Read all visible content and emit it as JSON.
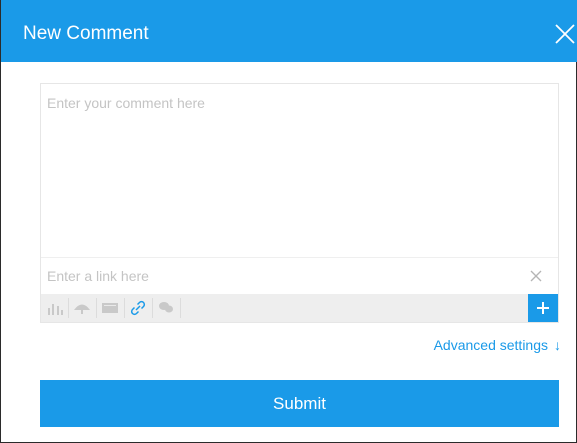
{
  "dialog": {
    "title": "New Comment",
    "close_icon": "close-icon"
  },
  "editor": {
    "comment_placeholder": "Enter your comment here",
    "comment_value": "",
    "link_placeholder": "Enter a link here",
    "link_value": "",
    "clear_icon": "close-icon"
  },
  "toolbar": {
    "items": [
      "bar-chart-icon",
      "umbrella-icon",
      "storyboard-icon",
      "link-icon",
      "comment-icon"
    ],
    "add_label": "+"
  },
  "advanced_settings": {
    "label": "Advanced settings",
    "arrow": "↓"
  },
  "submit": {
    "label": "Submit"
  },
  "colors": {
    "accent": "#1a9ae8",
    "toolbar_bg": "#eeeeee",
    "icon_gray": "#c9c9c9"
  }
}
